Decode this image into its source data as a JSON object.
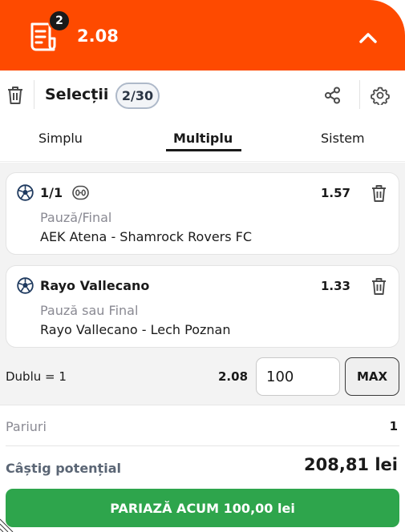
{
  "header": {
    "selections_badge": "2",
    "total_odds": "2.08"
  },
  "toolbar": {
    "title": "Selecții",
    "count": "2/30"
  },
  "tabs": [
    {
      "label": "Simplu"
    },
    {
      "label": "Multiplu"
    },
    {
      "label": "Sistem"
    }
  ],
  "selections": [
    {
      "pick": "1/1",
      "odds": "1.57",
      "market": "Pauză/Final",
      "event": "AEK Atena - Shamrock Rovers FC"
    },
    {
      "pick": "Rayo Vallecano",
      "odds": "1.33",
      "market": "Pauză sau Final",
      "event": "Rayo Vallecano - Lech Poznan"
    }
  ],
  "combo": {
    "label": "Dublu = 1",
    "odds": "2.08",
    "stake_value": "100",
    "max_label": "MAX"
  },
  "summary": {
    "bets_label": "Pariuri",
    "bets_value": "1",
    "potential_win_label": "Câștig potențial",
    "potential_win_value": "208,81 lei",
    "place_bet_label": "PARIAZĂ ACUM 100,00 lei"
  },
  "colors": {
    "header_bg": "#fe4a00",
    "place_bet_bg": "#2ea54c"
  }
}
